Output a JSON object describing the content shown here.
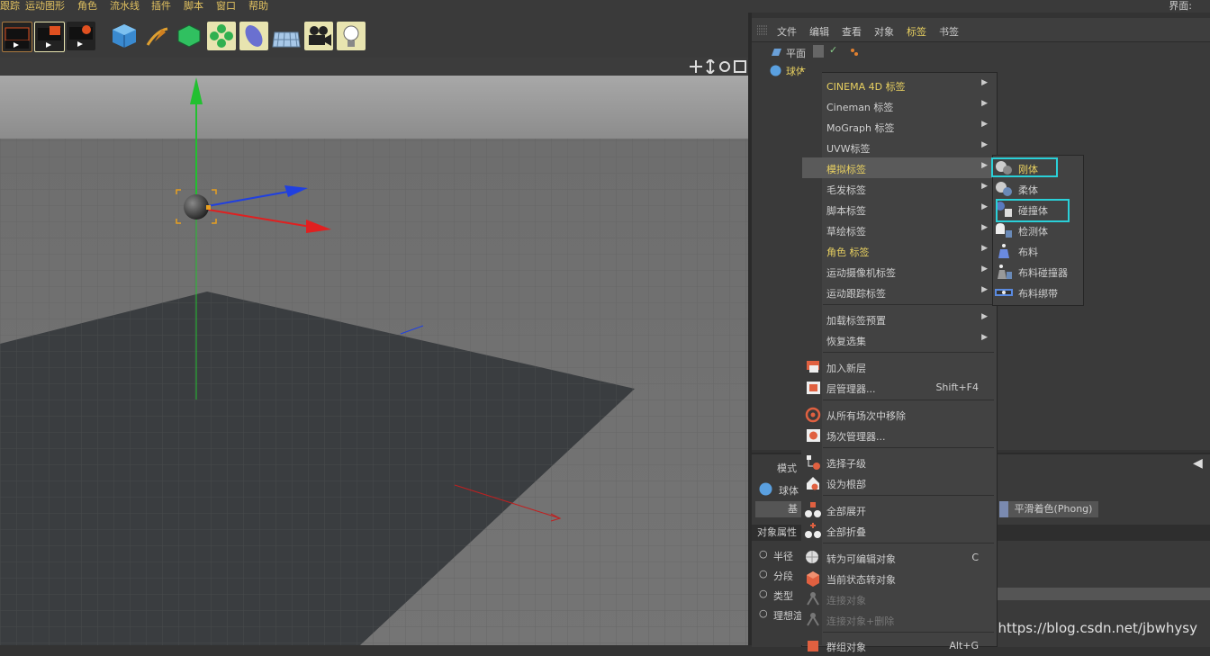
{
  "menubar": {
    "items": [
      "跟踪",
      "运动图形",
      "角色",
      "流水线",
      "插件",
      "脚本",
      "窗口",
      "帮助"
    ],
    "right_label": "界面:"
  },
  "toolbar": {
    "icons": [
      "render-view-icon",
      "render-picture-viewer-icon",
      "render-settings-icon",
      "cube-icon",
      "pen-icon",
      "subdivision-icon",
      "array-icon",
      "deformer-icon",
      "floor-icon",
      "camera-icon",
      "light-icon"
    ]
  },
  "object_manager": {
    "menu": [
      "文件",
      "编辑",
      "查看",
      "对象",
      "标签",
      "书签"
    ],
    "objects": [
      {
        "name": "平面",
        "icon": "plane-object-icon"
      },
      {
        "name": "球体",
        "icon": "sphere-object-icon"
      }
    ]
  },
  "attribute_manager": {
    "mode_label": "模式",
    "object_name": "球体",
    "tab_basic": "基",
    "tab_phong": "平滑着色(Phong)",
    "section_title": "对象属性",
    "params": [
      "半径",
      "分段",
      "类型",
      "理想渲"
    ]
  },
  "context_menu": {
    "items": [
      {
        "label": "CINEMA 4D 标签",
        "submenu": true,
        "style": "yellow"
      },
      {
        "label": "Cineman 标签",
        "submenu": true
      },
      {
        "label": "MoGraph 标签",
        "submenu": true
      },
      {
        "label": "UVW标签",
        "submenu": true
      },
      {
        "label": "模拟标签",
        "submenu": true,
        "style": "yellow",
        "active": true
      },
      {
        "label": "毛发标签",
        "submenu": true
      },
      {
        "label": "脚本标签",
        "submenu": true
      },
      {
        "label": "草绘标签",
        "submenu": true
      },
      {
        "label": "角色 标签",
        "submenu": true,
        "style": "yellow"
      },
      {
        "label": "运动摄像机标签",
        "submenu": true
      },
      {
        "label": "运动跟踪标签",
        "submenu": true
      },
      {
        "separator": true
      },
      {
        "label": "加载标签预置",
        "submenu": true
      },
      {
        "label": "恢复选集",
        "submenu": true
      },
      {
        "separator": true
      },
      {
        "label": "加入新层",
        "icon": "add-layer-icon"
      },
      {
        "label": "层管理器...",
        "shortcut": "Shift+F4",
        "icon": "layer-manager-icon"
      },
      {
        "separator": true
      },
      {
        "label": "从所有场次中移除",
        "icon": "take-remove-icon"
      },
      {
        "label": "场次管理器...",
        "icon": "take-manager-icon"
      },
      {
        "separator": true
      },
      {
        "label": "选择子级",
        "icon": "select-children-icon"
      },
      {
        "label": "设为根部",
        "icon": "set-root-icon"
      },
      {
        "separator": true
      },
      {
        "label": "全部展开",
        "icon": "expand-all-icon"
      },
      {
        "label": "全部折叠",
        "icon": "collapse-all-icon"
      },
      {
        "separator": true
      },
      {
        "label": "转为可编辑对象",
        "shortcut": "C",
        "icon": "make-editable-icon"
      },
      {
        "label": "当前状态转对象",
        "icon": "current-state-icon"
      },
      {
        "label": "连接对象",
        "disabled": true,
        "icon": "connect-objects-icon"
      },
      {
        "label": "连接对象+删除",
        "disabled": true,
        "icon": "connect-delete-icon"
      },
      {
        "separator": true
      },
      {
        "label": "群组对象",
        "shortcut": "Alt+G",
        "icon": "group-objects-icon"
      }
    ]
  },
  "submenu": {
    "items": [
      {
        "label": "刚体",
        "icon": "rigid-body-icon",
        "highlighted": true,
        "style": "yellow"
      },
      {
        "label": "柔体",
        "icon": "soft-body-icon"
      },
      {
        "label": "碰撞体",
        "icon": "collider-body-icon",
        "highlighted": true
      },
      {
        "label": "检测体",
        "icon": "ghost-body-icon"
      },
      {
        "label": "布料",
        "icon": "cloth-icon"
      },
      {
        "label": "布料碰撞器",
        "icon": "cloth-collider-icon"
      },
      {
        "label": "布料绑带",
        "icon": "cloth-belt-icon"
      }
    ]
  },
  "watermark": "https://blog.csdn.net/jbwhysy",
  "colors": {
    "accent_yellow": "#e8d060",
    "highlight_cyan": "#2ad0d8",
    "axis_y": "#22c030",
    "axis_x": "#e02020",
    "axis_z": "#2040e0"
  }
}
